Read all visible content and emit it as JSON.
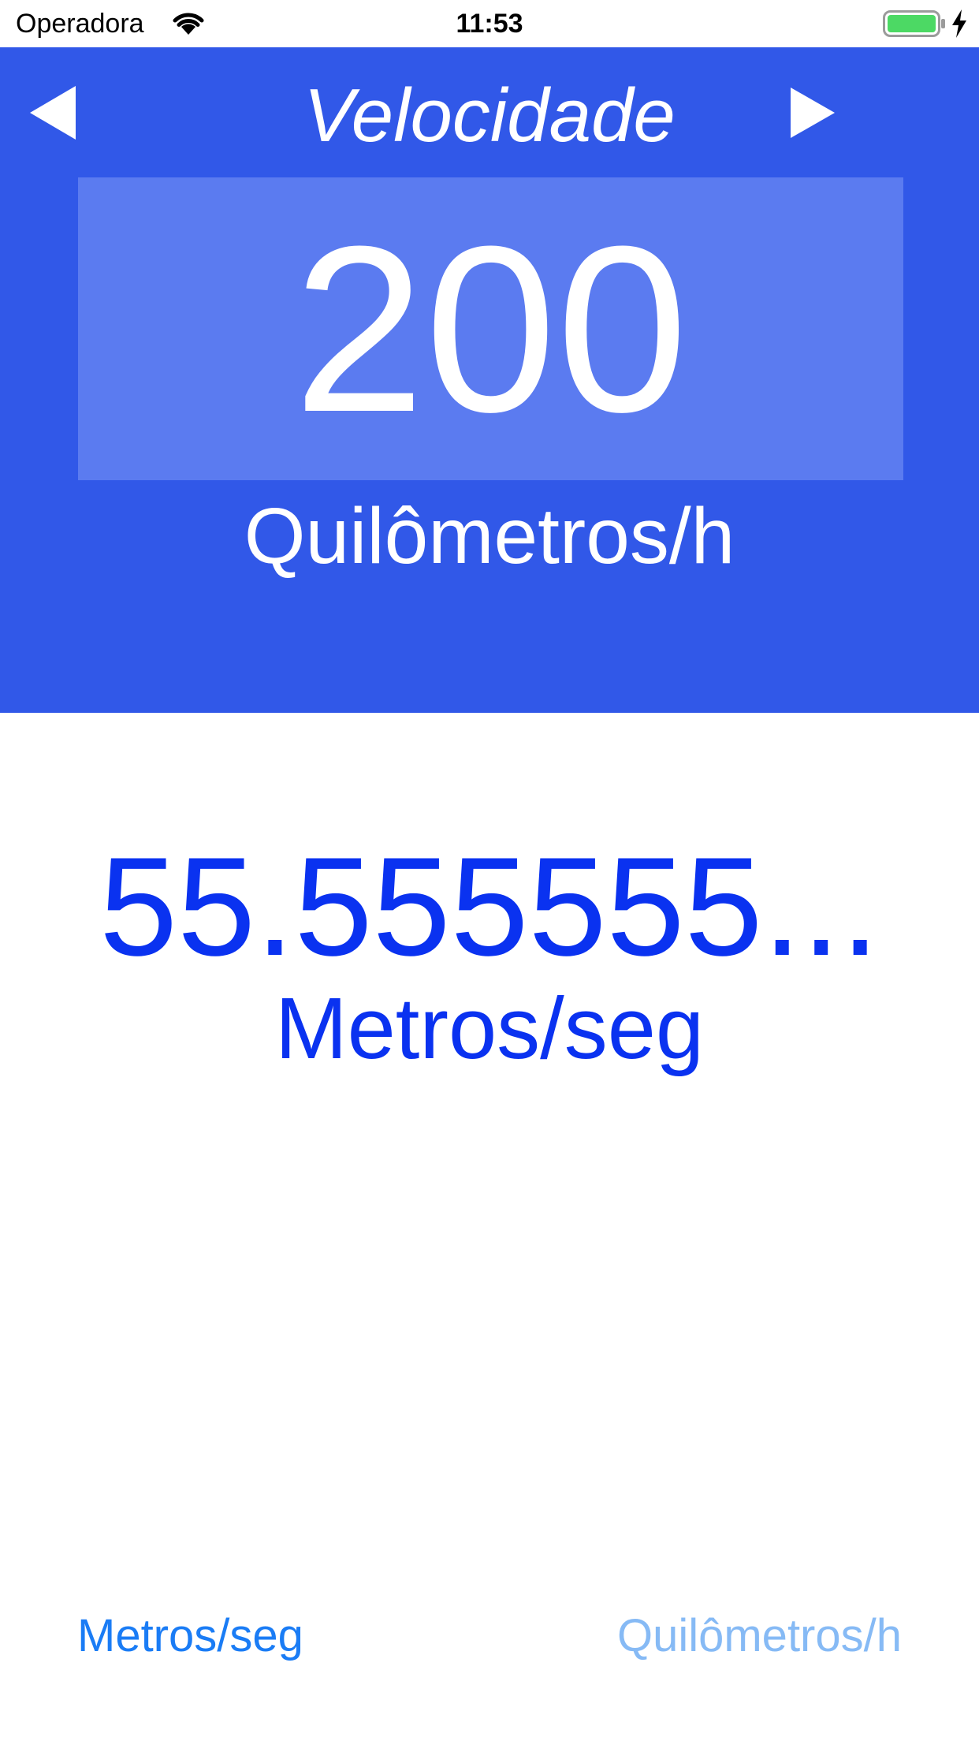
{
  "status_bar": {
    "carrier": "Operadora",
    "time": "11:53",
    "icons": [
      "wifi-icon",
      "battery-icon",
      "charging-icon"
    ]
  },
  "header": {
    "title": "Velocidade",
    "prev_icon": "triangle-left-icon",
    "next_icon": "triangle-right-icon",
    "input_value": "200",
    "input_unit": "Quilômetros/h"
  },
  "result": {
    "value": "55.555555...",
    "unit": "Metros/seg"
  },
  "unit_selector": {
    "left_label": "Metros/seg",
    "right_label": "Quilômetros/h"
  },
  "colors": {
    "header_bg": "#3158e8",
    "input_box_bg": "#5b7bf0",
    "result_text": "#0a32f0",
    "selector_active": "#1a7cf5",
    "selector_inactive": "#86baf5",
    "battery_fill": "#4cd964"
  }
}
